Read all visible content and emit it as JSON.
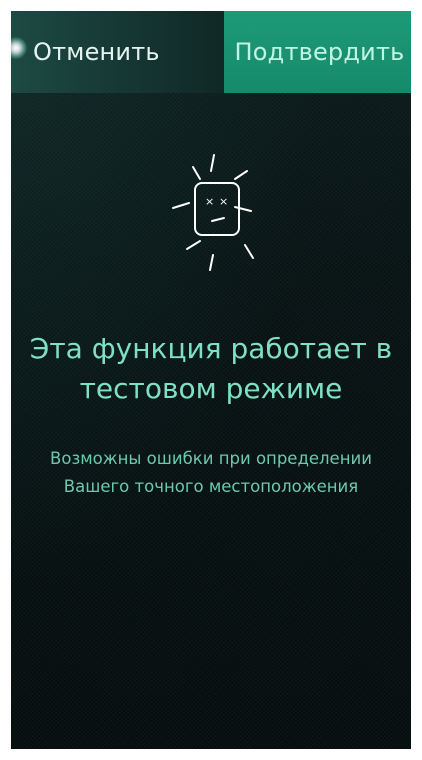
{
  "dialog": {
    "cancel_label": "Отменить",
    "confirm_label": "Подтвердить"
  },
  "notice": {
    "icon": "confused-face-icon",
    "title": "Эта функция работает в тестовом режиме",
    "message": "Возможны ошибки при определении Вашего точного местоположения"
  },
  "colors": {
    "accent": "#1e9a77",
    "title_text": "#7fe0c4",
    "message_text": "#6cc9ad",
    "background": "#081314"
  }
}
